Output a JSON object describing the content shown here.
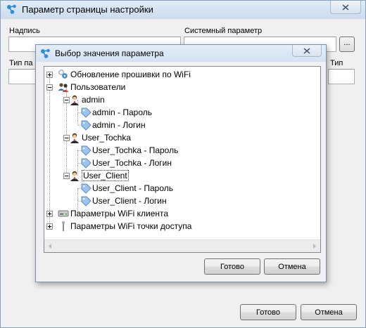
{
  "outer": {
    "title": "Параметр страницы настройки",
    "label_caption": "Надпись",
    "label_sysparam": "Системный параметр",
    "label_type": "Тип па",
    "label_right_partial": "Тип",
    "browse_label": "...",
    "ok_label": "Готово",
    "cancel_label": "Отмена"
  },
  "dialog": {
    "title": "Выбор значения параметра",
    "ok_label": "Готово",
    "cancel_label": "Отмена"
  },
  "tree": [
    {
      "label": "Обновление прошивки по WiFi",
      "icon": "firmware-icon",
      "level": 0,
      "expander": "plus"
    },
    {
      "label": "Пользователи",
      "icon": "users-group-icon",
      "level": 0,
      "expander": "minus"
    },
    {
      "label": "admin",
      "icon": "user-icon",
      "level": 1,
      "expander": "minus"
    },
    {
      "label": "admin - Пароль",
      "icon": "tag-icon",
      "level": 2
    },
    {
      "label": "admin - Логин",
      "icon": "tag-icon",
      "level": 2
    },
    {
      "label": "User_Tochka",
      "icon": "user-icon",
      "level": 1,
      "expander": "minus"
    },
    {
      "label": "User_Tochka - Пароль",
      "icon": "tag-icon",
      "level": 2
    },
    {
      "label": "User_Tochka - Логин",
      "icon": "tag-icon",
      "level": 2
    },
    {
      "label": "User_Client",
      "icon": "user-icon",
      "level": 1,
      "expander": "minus",
      "selected": true
    },
    {
      "label": "User_Client - Пароль",
      "icon": "tag-icon",
      "level": 2
    },
    {
      "label": "User_Client - Логин",
      "icon": "tag-icon",
      "level": 2
    },
    {
      "label": "Параметры WiFi клиента",
      "icon": "drive-icon",
      "level": 0,
      "expander": "plus"
    },
    {
      "label": "Параметры WiFi точки доступа",
      "icon": "antenna-icon",
      "level": 0,
      "expander": "plus"
    }
  ]
}
